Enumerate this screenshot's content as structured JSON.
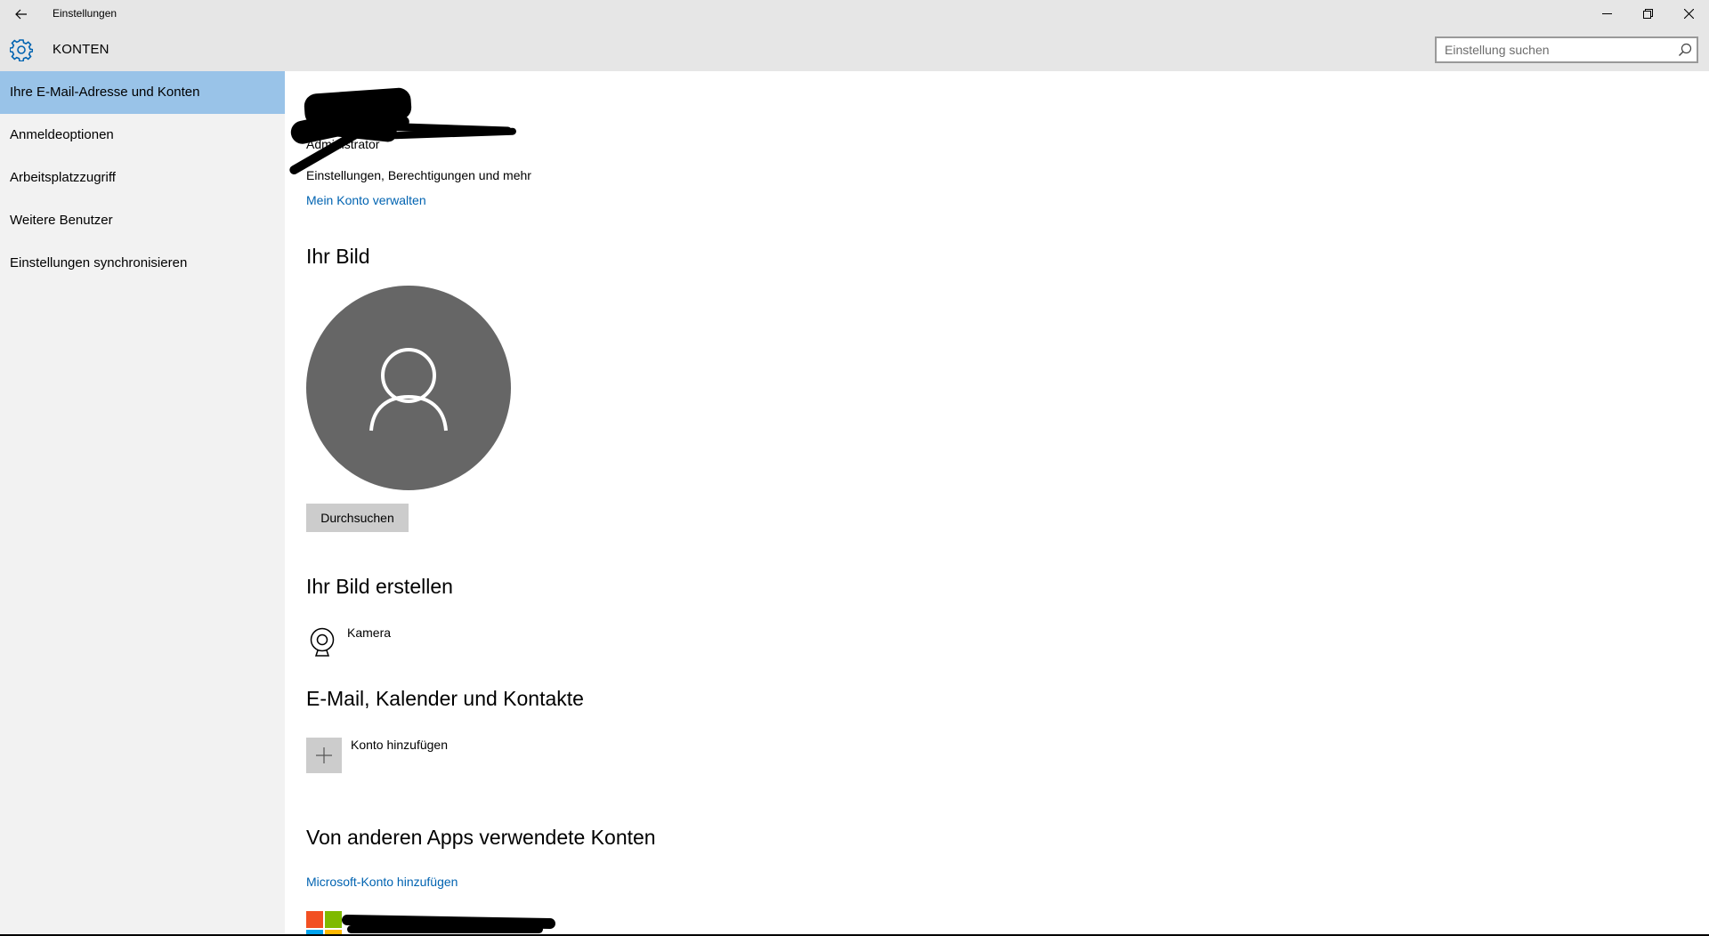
{
  "window": {
    "title": "Einstellungen"
  },
  "header": {
    "section": "KONTEN",
    "search_placeholder": "Einstellung suchen"
  },
  "sidebar": {
    "items": [
      {
        "label": "Ihre E-Mail-Adresse und Konten",
        "active": true
      },
      {
        "label": "Anmeldeoptionen",
        "active": false
      },
      {
        "label": "Arbeitsplatzzugriff",
        "active": false
      },
      {
        "label": "Weitere Benutzer",
        "active": false
      },
      {
        "label": "Einstellungen synchronisieren",
        "active": false
      }
    ]
  },
  "account": {
    "role": "Administrator",
    "description": "Einstellungen, Berechtigungen und mehr",
    "manage_link": "Mein Konto verwalten"
  },
  "picture": {
    "heading": "Ihr Bild",
    "browse_button": "Durchsuchen"
  },
  "create_picture": {
    "heading": "Ihr Bild erstellen",
    "camera_label": "Kamera"
  },
  "mail": {
    "heading": "E-Mail, Kalender und Kontakte",
    "add_account": "Konto hinzufügen"
  },
  "other_apps": {
    "heading": "Von anderen Apps verwendete Konten",
    "add_ms_account": "Microsoft-Konto hinzufügen"
  },
  "colors": {
    "accent": "#0063b1",
    "nav_active": "#99c3e8",
    "chrome": "#e6e6e6",
    "sidebar": "#f2f2f2",
    "avatar_bg": "#666666"
  }
}
